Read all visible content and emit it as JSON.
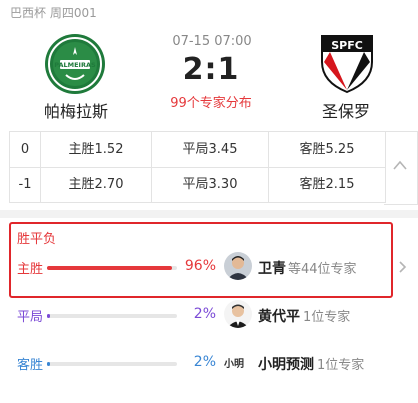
{
  "header": {
    "league": "巴西杯 周四001",
    "match_time": "07-15 07:00",
    "score": "2:1",
    "experts_link": "99个专家分布",
    "home": {
      "name": "帕梅拉斯",
      "logo_icon": "palmeiras-crest-icon",
      "logo_text": "PALMEIRAS"
    },
    "away": {
      "name": "圣保罗",
      "logo_icon": "spfc-crest-icon",
      "logo_text": "SPFC"
    }
  },
  "odds": {
    "rows": [
      {
        "handicap": "0",
        "win": "主胜1.52",
        "draw": "平局3.45",
        "lose": "客胜5.25"
      },
      {
        "handicap": "-1",
        "win": "主胜2.70",
        "draw": "平局3.30",
        "lose": "客胜2.15"
      }
    ]
  },
  "predictions": {
    "title": "胜平负",
    "rows": [
      {
        "label": "主胜",
        "percent": "96%",
        "value": 0.96,
        "color": "#e5383b",
        "expert": "卫青",
        "count": "等44位专家",
        "avatar": "avatar-photo"
      },
      {
        "label": "平局",
        "percent": "2%",
        "value": 0.02,
        "color": "#7b4bd6",
        "expert": "黄代平",
        "count": "1位专家",
        "avatar": "avatar-photo"
      },
      {
        "label": "客胜",
        "percent": "2%",
        "value": 0.02,
        "color": "#3a86d4",
        "expert": "小明预测",
        "count": "1位专家",
        "avatar": "xiaoming-logo",
        "avatar_text": "小明"
      }
    ]
  },
  "colors": {
    "accent": "#e5383b",
    "highlight_border": "#e0262b"
  }
}
